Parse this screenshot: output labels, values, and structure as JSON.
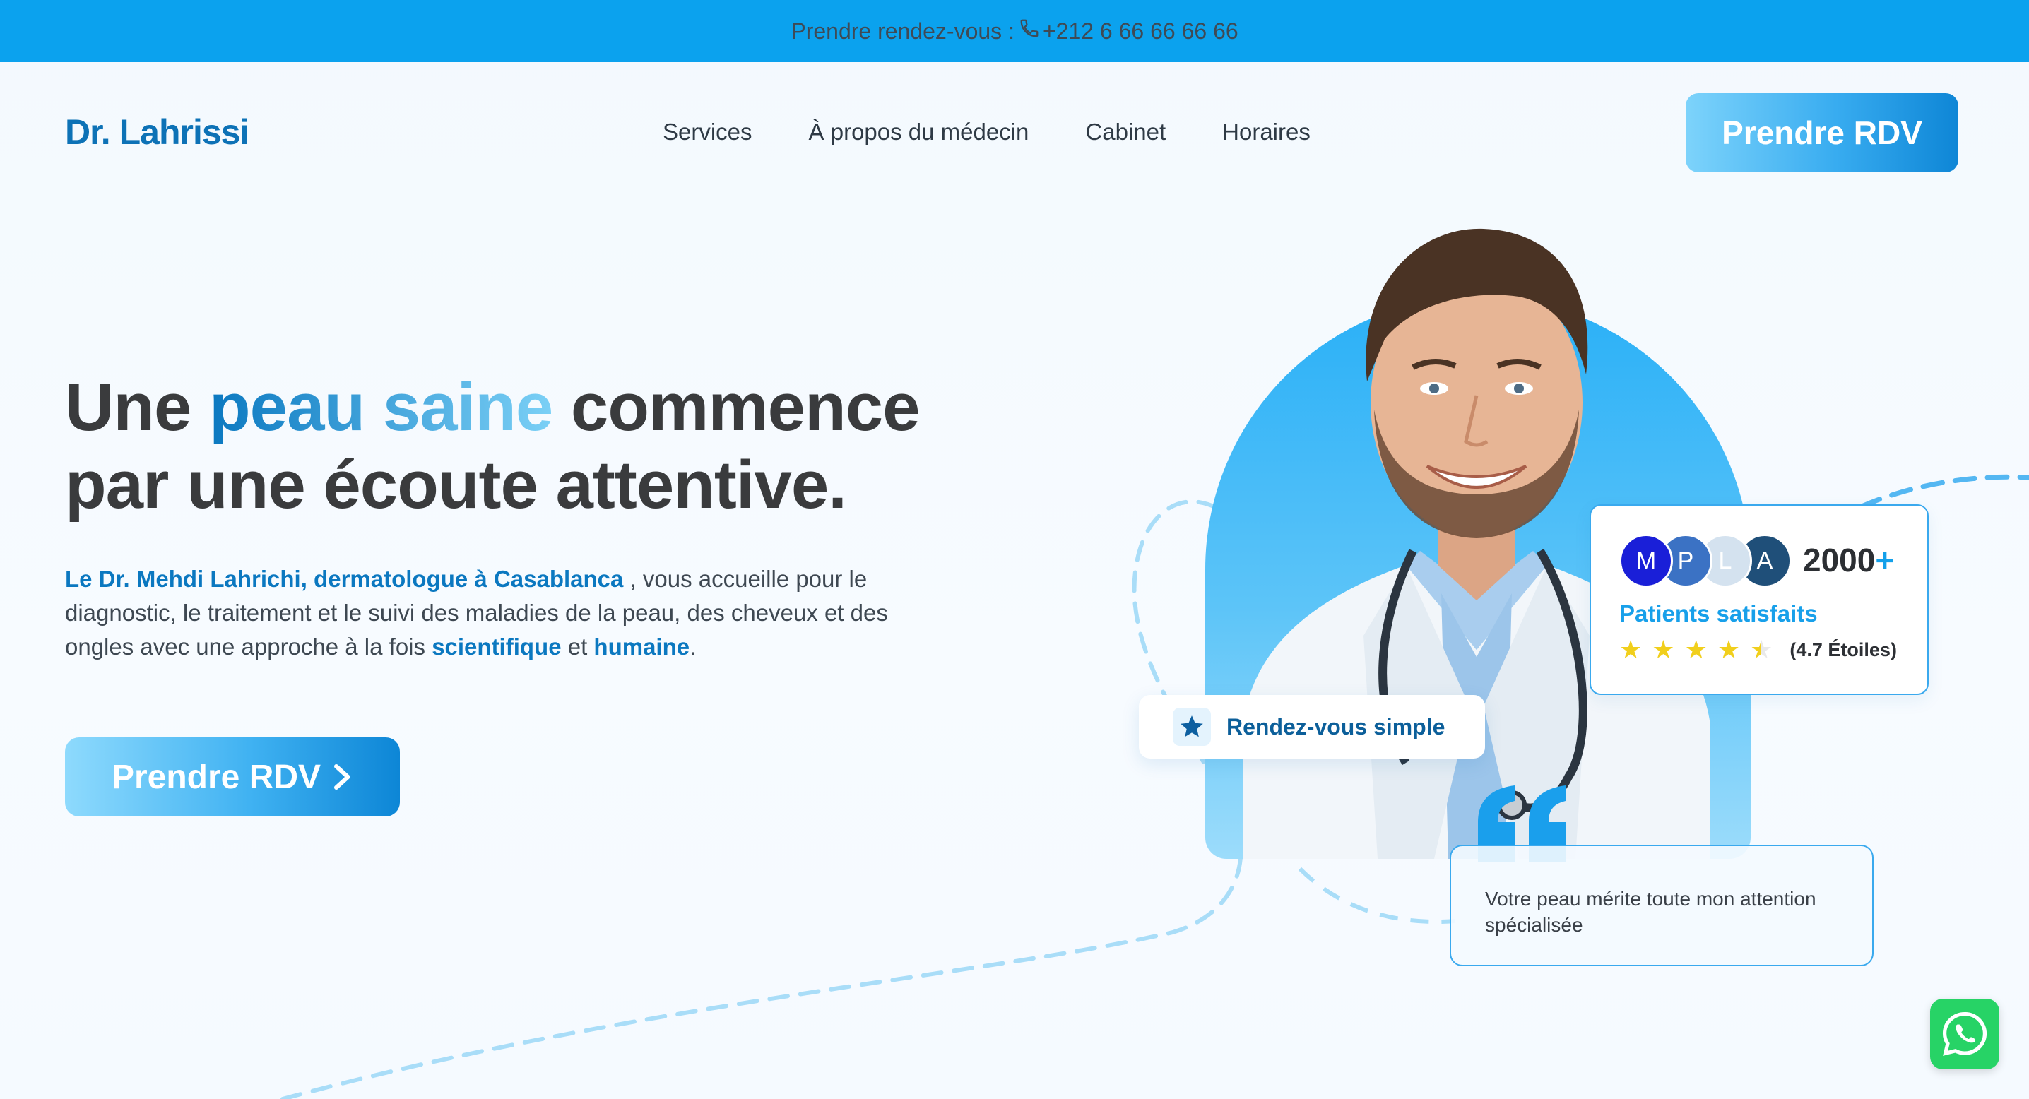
{
  "topbar": {
    "text": "Prendre rendez-vous :",
    "phone": "+212 6 66 66 66 66",
    "icon": "phone-icon"
  },
  "header": {
    "logo": "Dr. Lahrissi",
    "nav": [
      "Services",
      "À propos du médecin",
      "Cabinet",
      "Horaires"
    ],
    "cta": "Prendre RDV"
  },
  "hero": {
    "title_1": "Une ",
    "title_highlight": "peau saine",
    "title_2": " commence",
    "title_3": "par une écoute attentive.",
    "desc_bold_1": "Le Dr. Mehdi Lahrichi, dermatologue à Casablanca",
    "desc_text_1": " , vous accueille pour le diagnostic, le traitement et le suivi des maladies de la peau, des cheveux et des ongles avec une approche à la fois ",
    "desc_bold_2": "scientifique",
    "desc_text_2": " et ",
    "desc_bold_3": "humaine",
    "desc_text_3": ".",
    "cta": "Prendre RDV"
  },
  "patients_card": {
    "avatars": [
      {
        "letter": "M",
        "color": "#1a1fd8"
      },
      {
        "letter": "P",
        "color": "#3b72c4"
      },
      {
        "letter": "L",
        "color": "#d4e2ef"
      },
      {
        "letter": "A",
        "color": "#1f4f79"
      }
    ],
    "count": "2000",
    "plus": "+",
    "label": "Patients satisfaits",
    "stars": 4.5,
    "rating": "(4.7 Étoiles)"
  },
  "rdv_card": {
    "label": "Rendez-vous simple",
    "icon": "star-icon"
  },
  "quote_card": {
    "text": "Votre peau mérite toute mon attention spécialisée",
    "icon": "quote-icon"
  },
  "whatsapp": {
    "icon": "whatsapp-icon"
  },
  "colors": {
    "topbar": "#0ba2ee",
    "accent": "#0b78c0",
    "light_accent": "#18a0ea",
    "whatsapp": "#27d366"
  }
}
